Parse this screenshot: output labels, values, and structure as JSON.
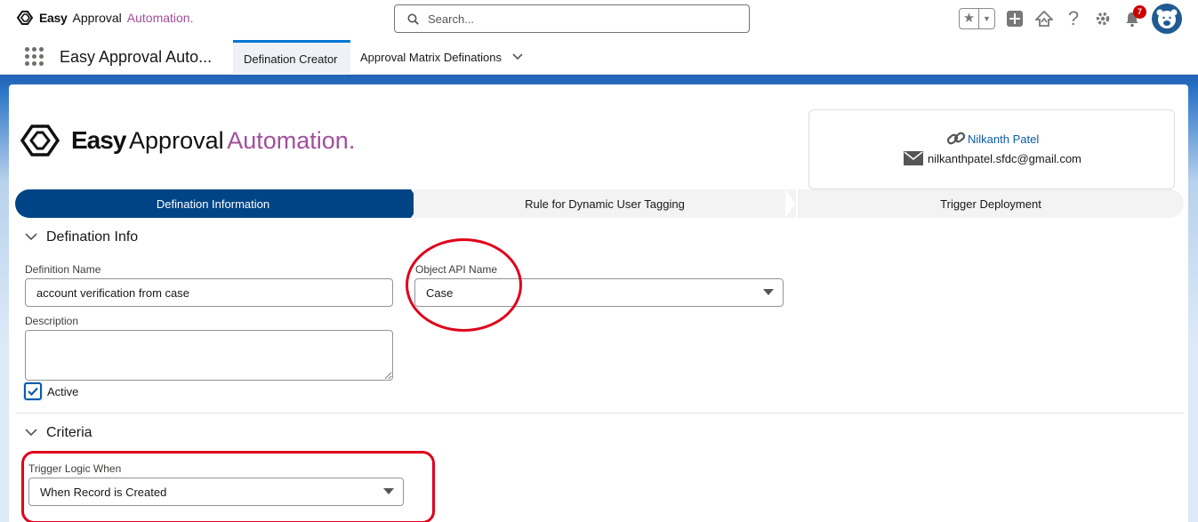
{
  "header": {
    "brand": {
      "word1": "Easy",
      "word2": "Approval",
      "word3": "Automation."
    },
    "search": {
      "placeholder": "Search..."
    },
    "notifications_count": "7",
    "icons": [
      "star-icon",
      "chevron-down-icon",
      "add-icon",
      "trailhead-icon",
      "help-icon",
      "gear-icon",
      "bell-icon",
      "avatar"
    ]
  },
  "nav": {
    "app_name": "Easy Approval Auto...",
    "tabs": [
      {
        "label": "Defination Creator",
        "active": true
      },
      {
        "label": "Approval Matrix Definations",
        "active": false
      }
    ]
  },
  "hero": {
    "logo": {
      "word1": "Easy",
      "word2": "Approval",
      "word3": "Automation."
    },
    "profile": {
      "name": "Nilkanth Patel",
      "email": "nilkanthpatel.sfdc@gmail.com"
    }
  },
  "path": {
    "steps": [
      "Defination Information",
      "Rule for Dynamic User Tagging",
      "Trigger Deployment"
    ],
    "active_step": "Defination Information"
  },
  "definition_section": {
    "title": "Defination Info",
    "definition_name": {
      "label": "Definition Name",
      "value": "account verification from case"
    },
    "object_api_name": {
      "label": "Object API Name",
      "value": "Case"
    },
    "description": {
      "label": "Description",
      "value": ""
    },
    "active": {
      "label": "Active",
      "checked": true
    }
  },
  "criteria_section": {
    "title": "Criteria",
    "trigger_logic": {
      "label": "Trigger Logic When",
      "value": "When Record is Created"
    }
  },
  "colors": {
    "accent": "#0176d3",
    "path_active": "#014486",
    "brand_purple": "#a24f9c",
    "annotation_red": "#e0001b"
  }
}
